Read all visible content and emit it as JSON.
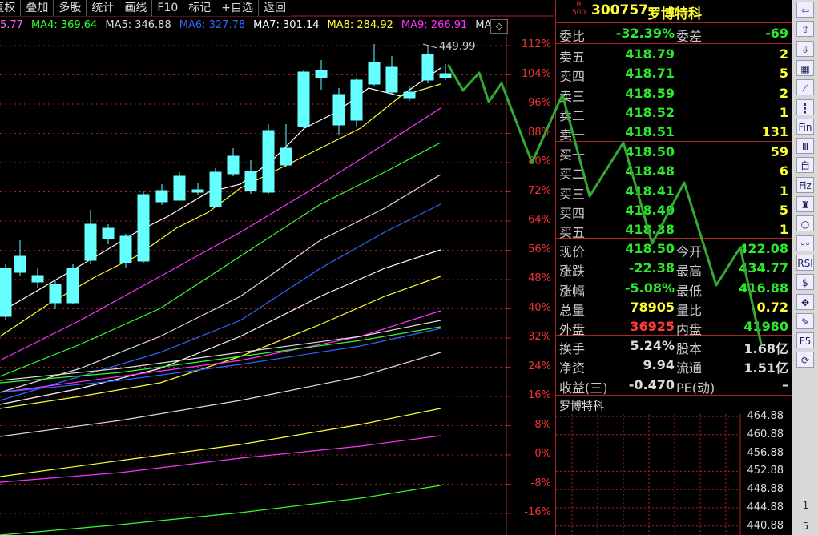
{
  "toolbar": {
    "buttons": [
      "复权",
      "叠加",
      "多股",
      "统计",
      "画线",
      "F10",
      "标记",
      "+自选",
      "返回"
    ]
  },
  "ma_legend": [
    {
      "label": "5.77",
      "color": "#ff66ff"
    },
    {
      "label": "MA4: 369.64",
      "color": "#33ff33"
    },
    {
      "label": "MA5: 346.88",
      "color": "#dddddd"
    },
    {
      "label": "MA6: 327.78",
      "color": "#3366ff"
    },
    {
      "label": "MA7: 301.14",
      "color": "#ffffff"
    },
    {
      "label": "MA8: 284.92",
      "color": "#ffff33"
    },
    {
      "label": "MA9: 266.91",
      "color": "#ff33ff"
    },
    {
      "label": "MA",
      "color": "#dddddd"
    }
  ],
  "legend_ctrl": "◇",
  "chart_data": {
    "type": "candlestick",
    "max_label": "449.99",
    "y_axis_ticks": [
      "112%",
      "104%",
      "96%",
      "88%",
      "80%",
      "72%",
      "64%",
      "56%",
      "48%",
      "40%",
      "32%",
      "24%",
      "16%",
      "8%",
      "0%",
      "-8%",
      "-16%"
    ],
    "y_axis_color": "#ee3333",
    "up_color": "#ee3333",
    "down_color": "#66ffff"
  },
  "stock": {
    "badge_top": "R",
    "badge_bottom": "500",
    "code": "300757",
    "name": "罗博特科"
  },
  "order_ratio": {
    "label": "委比",
    "value": "-32.39%",
    "label2": "委差",
    "value2": "-69"
  },
  "sell": [
    {
      "label": "卖五",
      "price": "418.79",
      "qty": "2"
    },
    {
      "label": "卖四",
      "price": "418.71",
      "qty": "5"
    },
    {
      "label": "卖三",
      "price": "418.59",
      "qty": "2"
    },
    {
      "label": "卖二",
      "price": "418.52",
      "qty": "1"
    },
    {
      "label": "卖一",
      "price": "418.51",
      "qty": "131"
    }
  ],
  "buy": [
    {
      "label": "买一",
      "price": "418.50",
      "qty": "59"
    },
    {
      "label": "买二",
      "price": "418.48",
      "qty": "6"
    },
    {
      "label": "买三",
      "price": "418.41",
      "qty": "1"
    },
    {
      "label": "买四",
      "price": "418.40",
      "qty": "5"
    },
    {
      "label": "买五",
      "price": "418.38",
      "qty": "1"
    }
  ],
  "stats": [
    {
      "l1": "现价",
      "v1": "418.50",
      "c1": "green",
      "l2": "今开",
      "v2": "422.08",
      "c2": "green"
    },
    {
      "l1": "涨跌",
      "v1": "-22.38",
      "c1": "green",
      "l2": "最高",
      "v2": "434.77",
      "c2": "green"
    },
    {
      "l1": "涨幅",
      "v1": "-5.08%",
      "c1": "green",
      "l2": "最低",
      "v2": "416.88",
      "c2": "green"
    },
    {
      "l1": "总量",
      "v1": "78905",
      "c1": "yellow",
      "l2": "量比",
      "v2": "0.72",
      "c2": "yellow"
    },
    {
      "l1": "外盘",
      "v1": "36925",
      "c1": "red",
      "l2": "内盘",
      "v2": "41980",
      "c2": "green"
    }
  ],
  "fund": [
    {
      "l1": "换手",
      "v1": "5.24%",
      "l2": "股本",
      "v2": "1.68亿"
    },
    {
      "l1": "净资",
      "v1": "9.94",
      "l2": "流通",
      "v2": "1.51亿"
    },
    {
      "l1": "收益(三)",
      "v1": "-0.470",
      "l2": "PE(动)",
      "v2": "–"
    }
  ],
  "mini": {
    "title": "罗博特科",
    "labels": [
      "464.88",
      "460.88",
      "456.88",
      "452.88",
      "448.88",
      "444.88",
      "440.88"
    ]
  },
  "right_toolbar": {
    "icons": [
      {
        "name": "back-arrow-icon",
        "glyph": "⇦"
      },
      {
        "name": "up-arrow-icon",
        "glyph": "⇧"
      },
      {
        "name": "down-arrow-icon",
        "glyph": "⇩"
      },
      {
        "name": "list-icon",
        "glyph": "▦"
      },
      {
        "name": "line-chart-icon",
        "glyph": "⟋"
      },
      {
        "name": "kline-icon",
        "glyph": "┇"
      },
      {
        "name": "fin-icon",
        "glyph": "Fin"
      },
      {
        "name": "doc-icon",
        "glyph": "Ⅲ"
      },
      {
        "name": "self-icon",
        "glyph": "自"
      },
      {
        "name": "fiz-icon",
        "glyph": "Fiz"
      },
      {
        "name": "figure-icon",
        "glyph": "♜"
      },
      {
        "name": "circle-icon",
        "glyph": "○"
      },
      {
        "name": "wave-icon",
        "glyph": "〰"
      },
      {
        "name": "rsi-icon",
        "glyph": "RSI"
      },
      {
        "name": "dollar-icon",
        "glyph": "$"
      },
      {
        "name": "move-icon",
        "glyph": "✥"
      },
      {
        "name": "pen-icon",
        "glyph": "✎"
      },
      {
        "name": "f5-icon",
        "glyph": "F5"
      },
      {
        "name": "refresh-icon",
        "glyph": "⟳"
      }
    ],
    "nums": [
      "1",
      "5"
    ]
  }
}
